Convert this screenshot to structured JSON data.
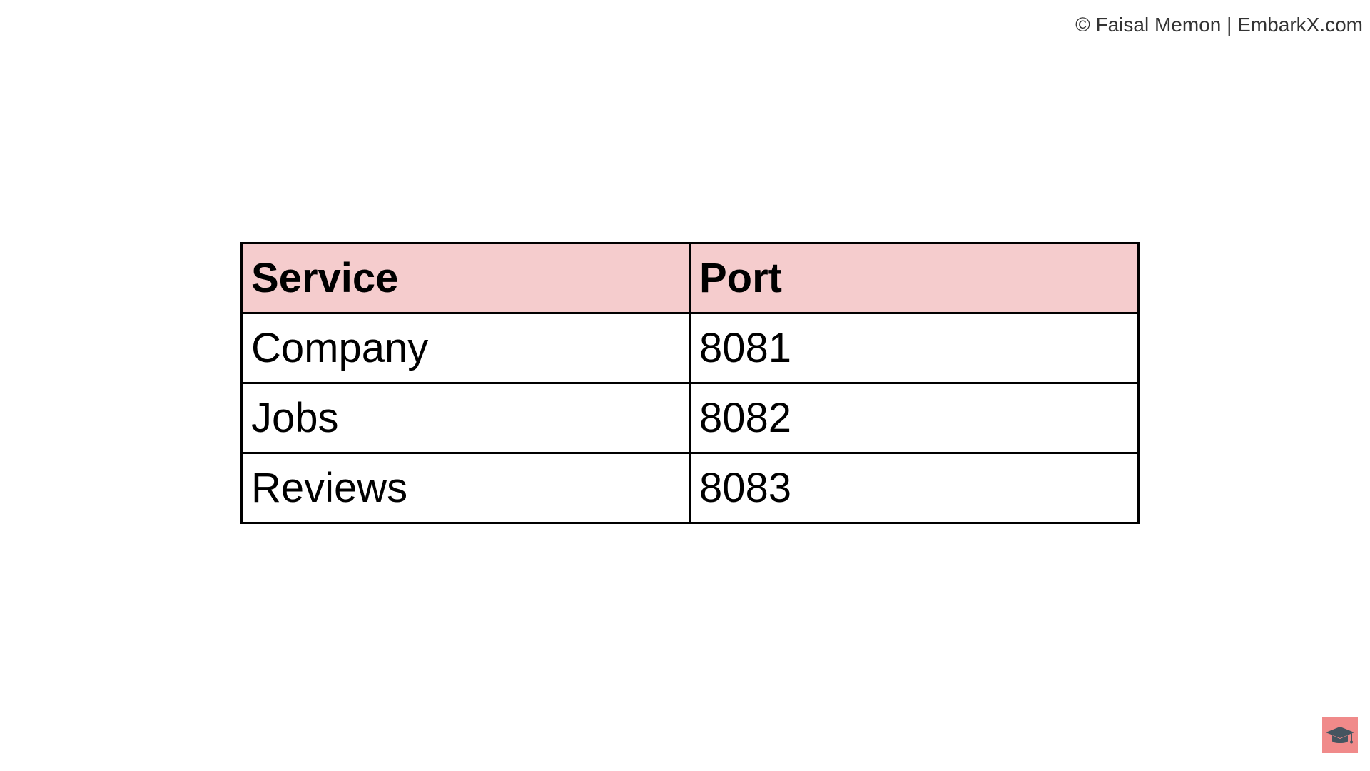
{
  "watermark": {
    "text": "© Faisal Memon | EmbarkX.com"
  },
  "table": {
    "headers": [
      "Service",
      "Port"
    ],
    "rows": [
      [
        "Company",
        "8081"
      ],
      [
        "Jobs",
        "8082"
      ],
      [
        "Reviews",
        "8083"
      ]
    ]
  },
  "colors": {
    "header_background": "#f5cccd",
    "border": "#000000",
    "badge_background": "#f08a8a",
    "icon_color": "#455560"
  },
  "icons": {
    "badge_icon": "graduation-cap-icon"
  }
}
